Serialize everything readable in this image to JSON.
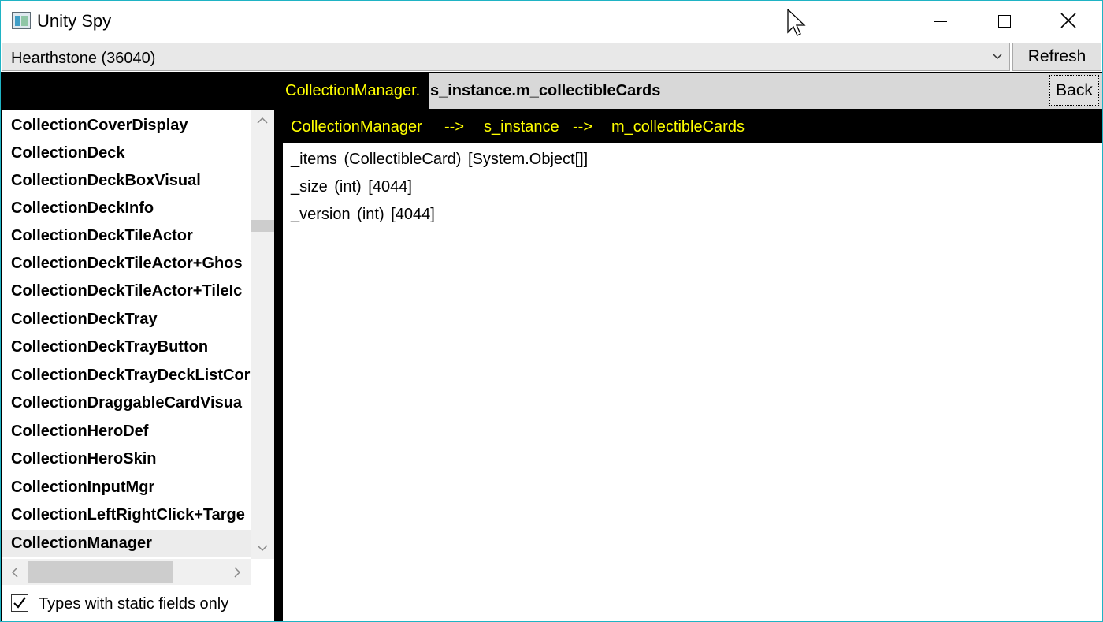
{
  "window": {
    "title": "Unity Spy",
    "accent_color": "#1fb3c4"
  },
  "process": {
    "selected": "Hearthstone  (36040)",
    "refresh_label": "Refresh"
  },
  "path": {
    "class_part": "CollectionManager.",
    "member_part": "s_instance.m_collectibleCards",
    "back_label": "Back"
  },
  "type_list": {
    "items": [
      "CollectionCoverDisplay",
      "CollectionDeck",
      "CollectionDeckBoxVisual",
      "CollectionDeckInfo",
      "CollectionDeckTileActor",
      "CollectionDeckTileActor+Ghos",
      "CollectionDeckTileActor+TileIc",
      "CollectionDeckTray",
      "CollectionDeckTrayButton",
      "CollectionDeckTrayDeckListCor",
      "CollectionDraggableCardVisua",
      "CollectionHeroDef",
      "CollectionHeroSkin",
      "CollectionInputMgr",
      "CollectionLeftRightClick+Targe",
      "CollectionManager"
    ],
    "selected": "CollectionManager"
  },
  "static_only": {
    "label": "Types with static fields only",
    "checked": true
  },
  "breadcrumb": {
    "items": [
      "CollectionManager",
      "s_instance",
      "m_collectibleCards"
    ],
    "separator": "-->"
  },
  "fields": [
    {
      "name": "_items",
      "type": "(CollectibleCard)",
      "value": "[System.Object[]]"
    },
    {
      "name": "_size",
      "type": "(int)",
      "value": "[4044]"
    },
    {
      "name": "_version",
      "type": "(int)",
      "value": "[4044]"
    }
  ],
  "colors": {
    "highlight_text": "#ffff00",
    "panel_background": "#000000",
    "path_background": "#d8d8d8"
  }
}
